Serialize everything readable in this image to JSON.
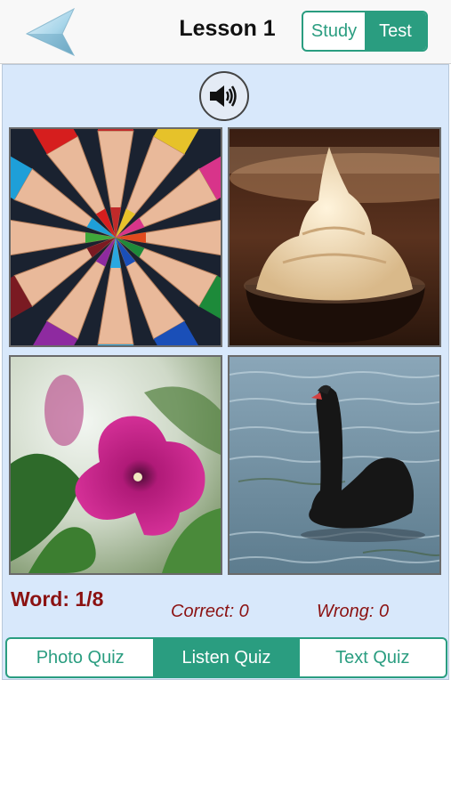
{
  "navbar": {
    "back_icon": "back-arrow-icon",
    "title": "Lesson 1",
    "segments": [
      {
        "label": "Study",
        "active": false
      },
      {
        "label": "Test",
        "active": true
      }
    ],
    "accent_color": "#2a9d80"
  },
  "quiz": {
    "speaker_icon": "speaker-icon",
    "photos": [
      {
        "subject": "colored pencils"
      },
      {
        "subject": "soft serve ice cream"
      },
      {
        "subject": "purple flower"
      },
      {
        "subject": "black swan"
      }
    ],
    "word_progress": "Word: 1/8",
    "correct": "Correct: 0",
    "wrong": "Wrong: 0",
    "status_color": "#8b1212",
    "background_color": "#d8e8fb"
  },
  "tabs": [
    {
      "label": "Photo Quiz",
      "active": false
    },
    {
      "label": "Listen Quiz",
      "active": true
    },
    {
      "label": "Text Quiz",
      "active": false
    }
  ]
}
